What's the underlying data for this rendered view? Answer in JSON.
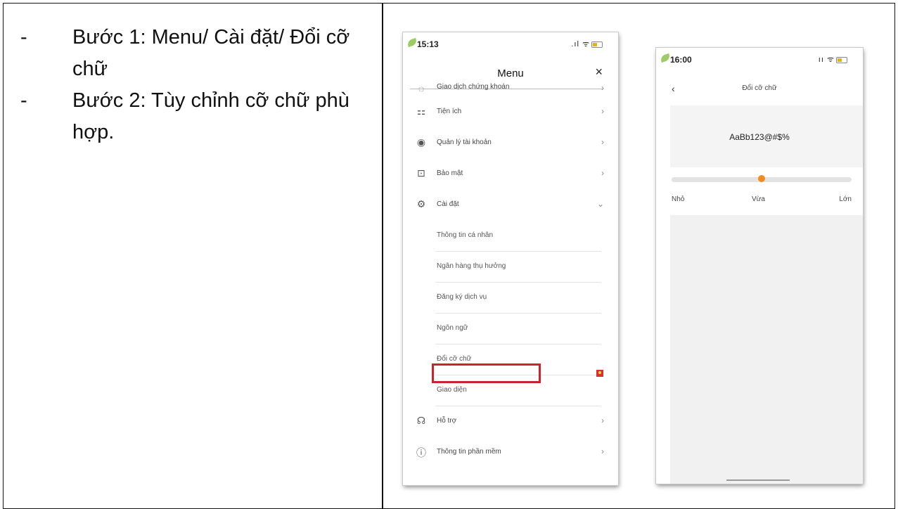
{
  "instructions": {
    "steps": [
      {
        "dash": "-",
        "text": "Bước 1: Menu/ Cài đặt/ Đổi cỡ chữ"
      },
      {
        "dash": "-",
        "text": "Bước 2: Tùy chỉnh cỡ chữ phù hợp."
      }
    ]
  },
  "screen_menu": {
    "status_time": "15:13",
    "status_icons": ".ıl ᯤ",
    "title": "Menu",
    "close_glyph": "×",
    "items": [
      {
        "label": "Giao dịch chứng khoán",
        "icon": "tag-icon",
        "glyph": "◌",
        "chevron": "›"
      },
      {
        "label": "Tiện ích",
        "icon": "grid-plus-icon",
        "glyph": "⚏",
        "chevron": "›"
      },
      {
        "label": "Quản lý tài khoản",
        "icon": "user-circle-icon",
        "glyph": "◉",
        "chevron": "›"
      },
      {
        "label": "Bảo mật",
        "icon": "lock-icon",
        "glyph": "⊡",
        "chevron": "›"
      },
      {
        "label": "Cài đặt",
        "icon": "gear-icon",
        "glyph": "⚙",
        "chevron": "⌄"
      },
      {
        "label": "Thông tin cá nhân"
      },
      {
        "label": "Ngân hàng thụ hưởng"
      },
      {
        "label": "Đăng ký dịch vụ"
      },
      {
        "label": "Ngôn ngữ"
      },
      {
        "label": "Đổi cỡ chữ"
      },
      {
        "label": "Giao diện"
      },
      {
        "label": "Hỗ trợ",
        "icon": "headset-icon",
        "glyph": "☊",
        "chevron": "›"
      },
      {
        "label": "Thông tin phần mềm",
        "icon": "info-icon",
        "glyph": "ⓘ",
        "chevron": "›"
      }
    ],
    "highlight_color": "#c9252c",
    "language_flag": "vietnam-flag-icon"
  },
  "screen_font": {
    "status_time": "16:00",
    "status_icons": "ıı ᯤ",
    "back_glyph": "‹",
    "title": "Đổi cỡ chữ",
    "preview_text": "AaBb123@#$%",
    "slider": {
      "value": 0.5,
      "labels": [
        "Nhỏ",
        "Vừa",
        "Lớn"
      ]
    },
    "accent_color": "#f08c1e"
  }
}
